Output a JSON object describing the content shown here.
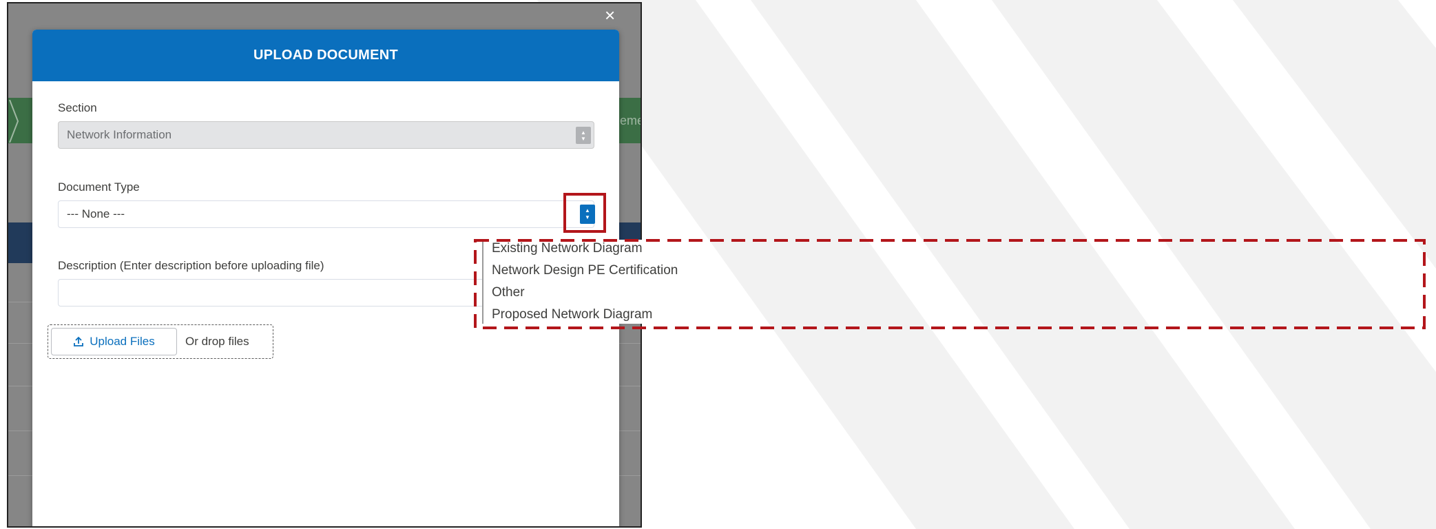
{
  "modal": {
    "title": "UPLOAD DOCUMENT",
    "close_symbol": "×",
    "section": {
      "label": "Section",
      "value": "Network Information"
    },
    "document_type": {
      "label": "Document Type",
      "value": "--- None ---"
    },
    "description": {
      "label": "Description (Enter description before uploading file)",
      "value": ""
    },
    "upload": {
      "button_label": "Upload Files",
      "drop_text": "Or drop files",
      "icon": "upload-icon"
    }
  },
  "dropdown": {
    "options": [
      "Existing Network Diagram",
      "Network Design PE Certification",
      "Other",
      "Proposed Network Diagram"
    ]
  },
  "background": {
    "partial_text": "eme"
  },
  "colors": {
    "header_blue": "#0a6fbd",
    "highlight_red": "#b3161b",
    "backdrop_gray": "#868686",
    "band_green": "#3b6e45",
    "band_navy": "#213a5a"
  }
}
